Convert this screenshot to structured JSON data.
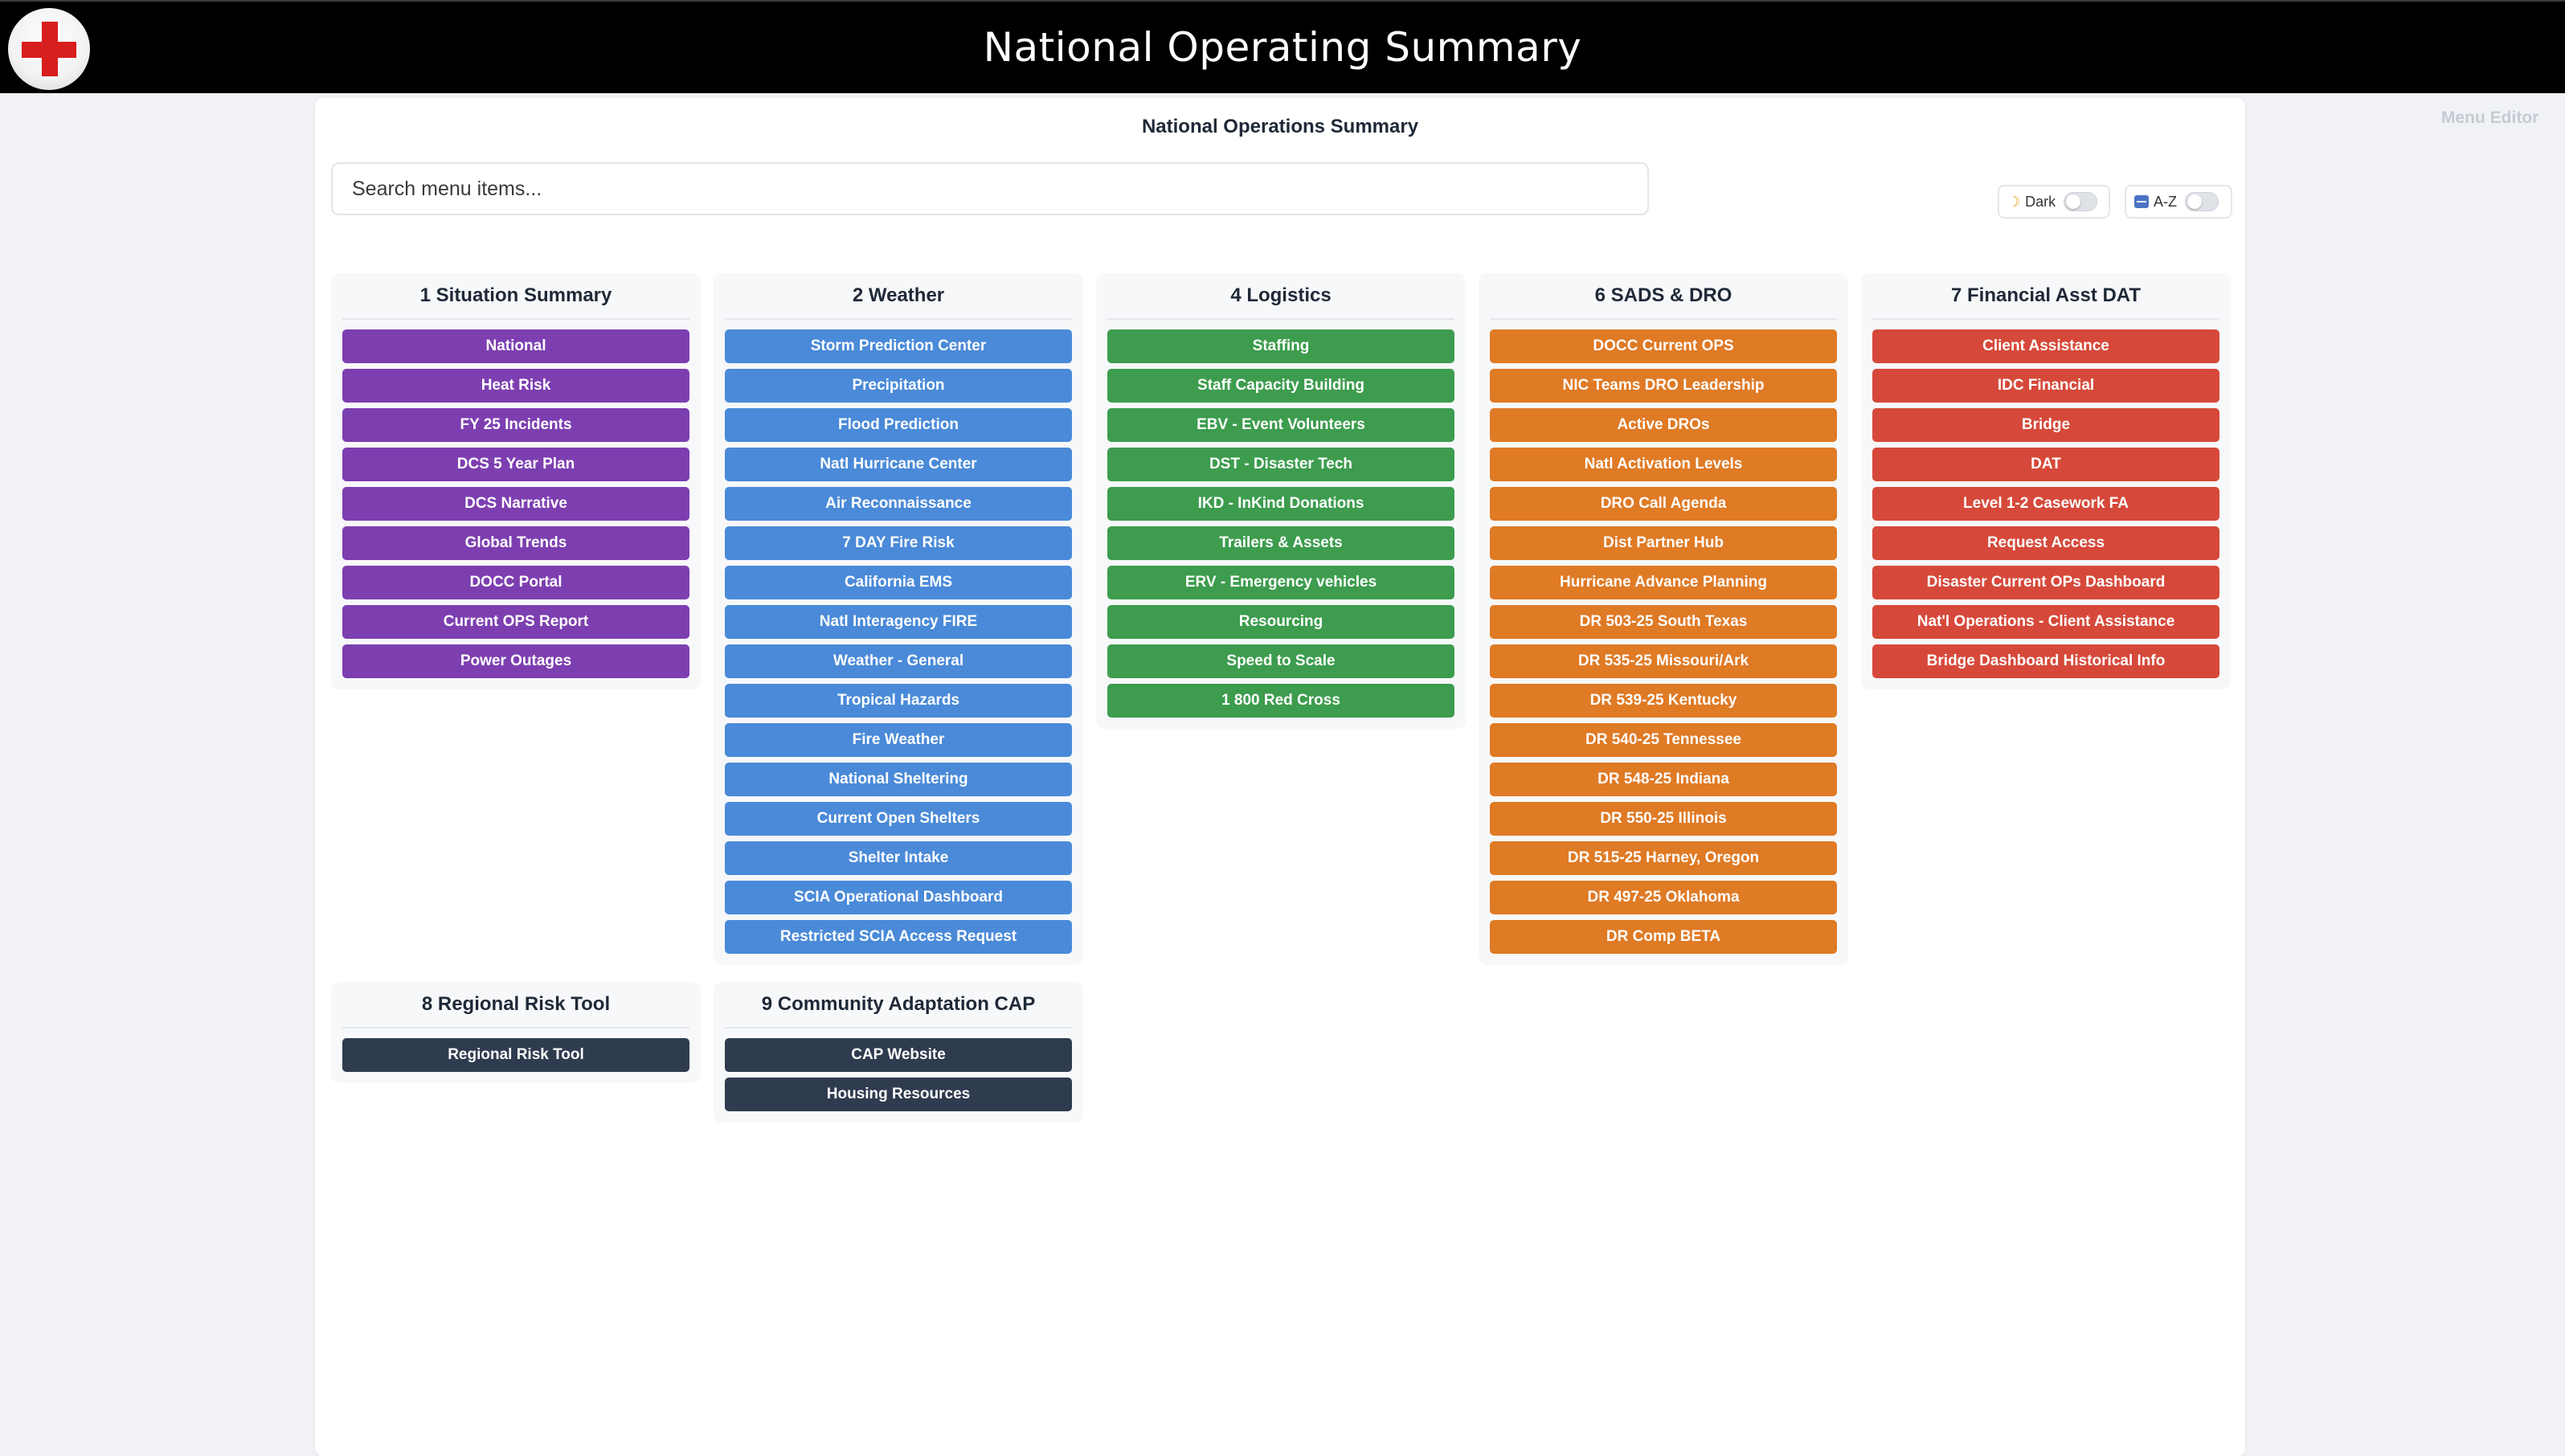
{
  "header": {
    "title": "National Operating Summary"
  },
  "menu_editor": "Menu Editor",
  "panel": {
    "title": "National Operations Summary",
    "search_placeholder": "Search menu items...",
    "toggles": {
      "dark_label": "Dark",
      "az_label": "A-Z"
    }
  },
  "colors": {
    "situation": "#7d3fb0",
    "weather": "#4a8ad8",
    "logistics": "#3d9c4e",
    "sads": "#df7a25",
    "financial": "#d6493a",
    "regional": "#2f3b4f"
  },
  "categories": [
    {
      "title": "1 Situation Summary",
      "items": [
        "National",
        "Heat Risk",
        "FY 25 Incidents",
        "DCS 5 Year Plan",
        "DCS Narrative",
        "Global Trends",
        "DOCC Portal",
        "Current OPS Report",
        "Power Outages"
      ]
    },
    {
      "title": "2 Weather",
      "items": [
        "Storm Prediction Center",
        "Precipitation",
        "Flood Prediction",
        "Natl Hurricane Center",
        "Air Reconnaissance",
        "7 DAY Fire Risk",
        "California EMS",
        "Natl Interagency FIRE",
        "Weather - General",
        "Tropical Hazards",
        "Fire Weather",
        "National Sheltering",
        "Current Open Shelters",
        "Shelter Intake",
        "SCIA Operational Dashboard",
        "Restricted SCIA Access Request"
      ]
    },
    {
      "title": "4 Logistics",
      "items": [
        "Staffing",
        "Staff Capacity Building",
        "EBV - Event Volunteers",
        "DST - Disaster Tech",
        "IKD - InKind Donations",
        "Trailers & Assets",
        "ERV - Emergency vehicles",
        "Resourcing",
        "Speed to Scale",
        "1 800 Red Cross"
      ]
    },
    {
      "title": "6 SADS & DRO",
      "items": [
        "DOCC Current OPS",
        "NIC Teams DRO Leadership",
        "Active DROs",
        "Natl Activation Levels",
        "DRO Call Agenda",
        "Dist Partner Hub",
        "Hurricane Advance Planning",
        "DR 503-25 South Texas",
        "DR 535-25 Missouri/Ark",
        "DR 539-25 Kentucky",
        "DR 540-25 Tennessee",
        "DR 548-25 Indiana",
        "DR 550-25 Illinois",
        "DR 515-25 Harney, Oregon",
        "DR 497-25 Oklahoma",
        "DR Comp BETA"
      ]
    },
    {
      "title": "7 Financial Asst DAT",
      "items": [
        "Client Assistance",
        "IDC Financial",
        "Bridge",
        "DAT",
        "Level 1-2 Casework FA",
        "Request Access",
        "Disaster Current OPs Dashboard",
        "Nat'l Operations - Client Assistance",
        "Bridge Dashboard Historical Info"
      ]
    },
    {
      "title": "8 Regional Risk Tool",
      "items": [
        "Regional Risk Tool"
      ]
    },
    {
      "title": "9 Community Adaptation CAP",
      "items": [
        "CAP Website",
        "Housing Resources"
      ]
    }
  ]
}
